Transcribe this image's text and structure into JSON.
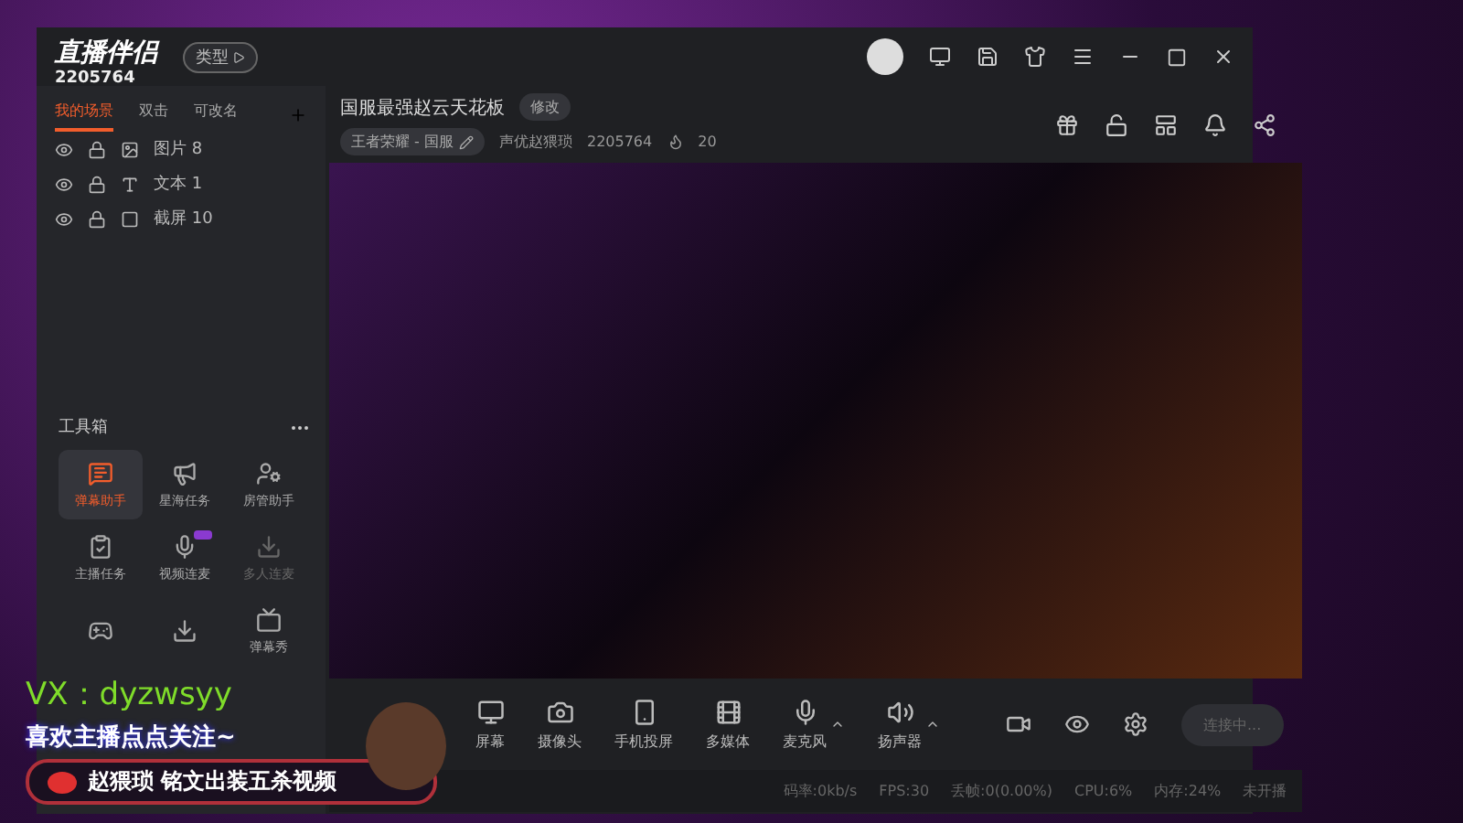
{
  "app": {
    "logo_text": "直播伴侣",
    "room_id": "2205764",
    "type_button": "类型"
  },
  "scene_tabs": [
    {
      "label": "我的场景",
      "selected": true
    },
    {
      "label": "双击",
      "selected": false
    },
    {
      "label": "可改名",
      "selected": false
    }
  ],
  "sources": [
    {
      "kind": "image",
      "label": "图片 8"
    },
    {
      "kind": "text",
      "label": "文本 1"
    },
    {
      "kind": "screen",
      "label": "截屏 10"
    }
  ],
  "toolbox": {
    "title": "工具箱",
    "tools": [
      {
        "kind": "danmaku",
        "label": "弹幕助手",
        "selected": true,
        "disabled": false
      },
      {
        "kind": "ad",
        "label": "星海任务",
        "selected": false,
        "disabled": false
      },
      {
        "kind": "admin",
        "label": "房管助手",
        "selected": false,
        "disabled": false
      },
      {
        "kind": "task",
        "label": "主播任务",
        "selected": false,
        "disabled": false
      },
      {
        "kind": "mic",
        "label": "视频连麦",
        "selected": false,
        "disabled": false
      },
      {
        "kind": "download",
        "label": "多人连麦",
        "selected": false,
        "disabled": true
      },
      {
        "kind": "game",
        "selected": false,
        "disabled": false
      },
      {
        "kind": "download",
        "selected": false,
        "disabled": false
      },
      {
        "kind": "tv",
        "label": "弹幕秀",
        "selected": false,
        "disabled": false
      }
    ]
  },
  "header": {
    "title": "国服最强赵云天花板",
    "edit_button": "修改",
    "category": "王者荣耀 - 国服",
    "streamer": "声优赵猥琐",
    "room_id": "2205764",
    "heat": "20"
  },
  "sources_bar": [
    {
      "kind": "screen",
      "label": "屏幕"
    },
    {
      "kind": "camera",
      "label": "摄像头"
    },
    {
      "kind": "phone",
      "label": "手机投屏"
    },
    {
      "kind": "media",
      "label": "多媒体"
    },
    {
      "kind": "mic",
      "label": "麦克风"
    },
    {
      "kind": "speaker",
      "label": "扬声器"
    }
  ],
  "connect_button": "连接中...",
  "status_bar": [
    "码率:0kb/s",
    "FPS:30",
    "丢帧:0(0.00%)",
    "CPU:6%",
    "内存:24%",
    "未开播"
  ],
  "overlay": {
    "wechat": "VX：dyzwsyy",
    "follow": "喜欢主播点点关注~",
    "weibo": "赵猥琐 铭文出装五杀视频"
  }
}
